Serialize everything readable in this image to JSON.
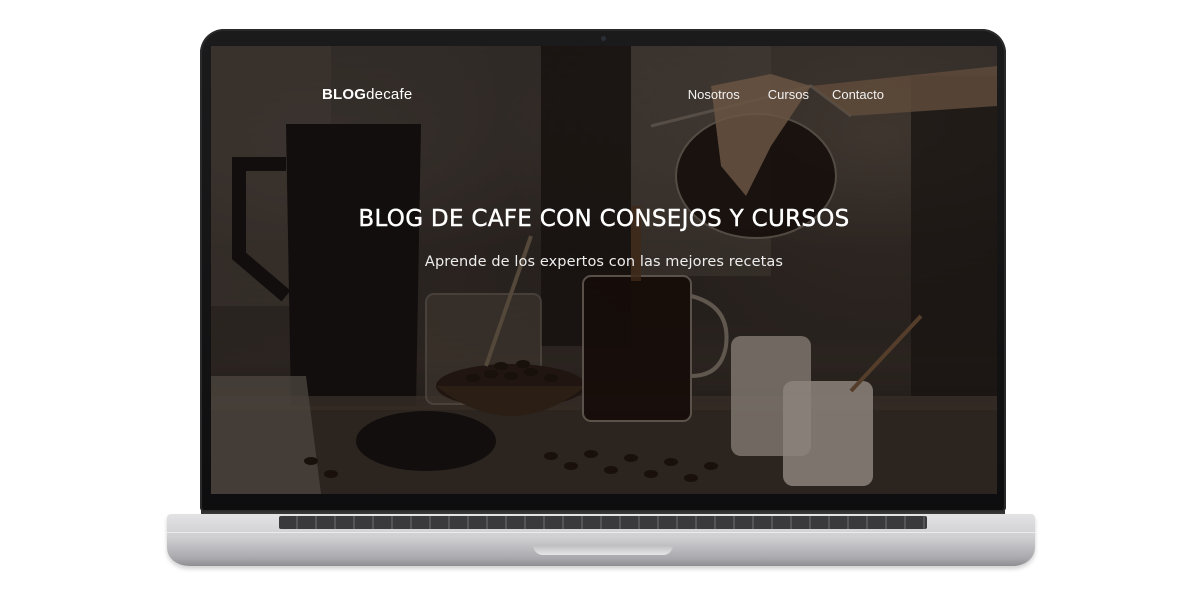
{
  "site": {
    "logo_bold": "BLOG",
    "logo_light": "decafe"
  },
  "nav": {
    "items": [
      {
        "label": "Nosotros"
      },
      {
        "label": "Cursos"
      },
      {
        "label": "Contacto"
      }
    ]
  },
  "hero": {
    "title": "BLOG DE CAFE CON CONSEJOS Y CURSOS",
    "subtitle": "Aprende de los expertos con las mejores recetas"
  },
  "colors": {
    "overlay": "#0f0a08",
    "text": "#ffffff",
    "laptop_frame": "#1b1b1c",
    "laptop_base": "#cfcfd2"
  }
}
